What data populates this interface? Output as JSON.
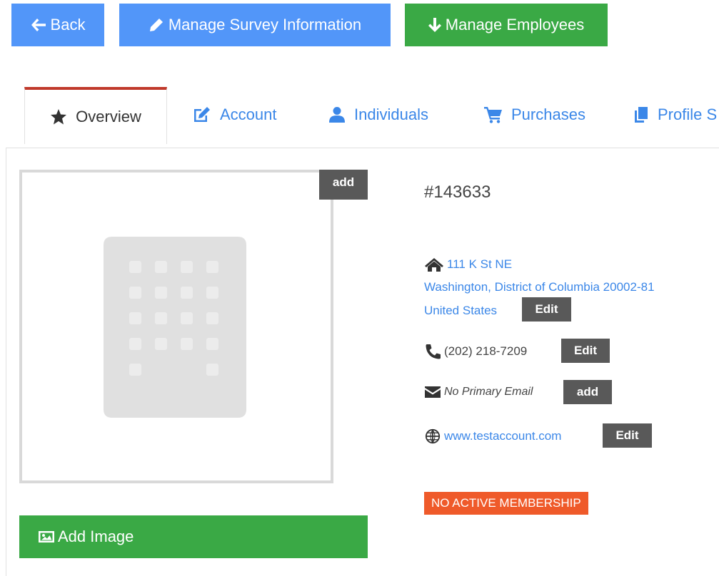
{
  "toolbar": {
    "back_label": "Back",
    "survey_label": "Manage Survey Information",
    "employees_label": "Manage Employees"
  },
  "tabs": [
    {
      "label": "Overview",
      "icon": "star-icon",
      "active": true
    },
    {
      "label": "Account",
      "icon": "edit-icon"
    },
    {
      "label": "Individuals",
      "icon": "user-icon"
    },
    {
      "label": "Purchases",
      "icon": "cart-icon"
    },
    {
      "label": "Profile S",
      "icon": "copy-icon"
    }
  ],
  "image": {
    "add_tag": "add",
    "placeholder_icon": "building-icon",
    "add_image_label": "Add Image"
  },
  "account": {
    "id": "#143633",
    "address_line1": "111 K St NE",
    "address_line2": "Washington, District of Columbia 20002-81",
    "address_line3": "United States",
    "address_edit": "Edit",
    "phone": "(202) 218-7209",
    "phone_edit": "Edit",
    "email": "No Primary Email",
    "email_add": "add",
    "website": "www.testaccount.com",
    "website_edit": "Edit",
    "membership_status": "NO ACTIVE MEMBERSHIP"
  },
  "colors": {
    "primary_blue": "#5296f9",
    "green": "#3aa945",
    "link_blue": "#3b87e8",
    "dark_tag": "#595959",
    "badge_orange": "#ef5a2a",
    "active_tab_top": "#c0392b"
  }
}
